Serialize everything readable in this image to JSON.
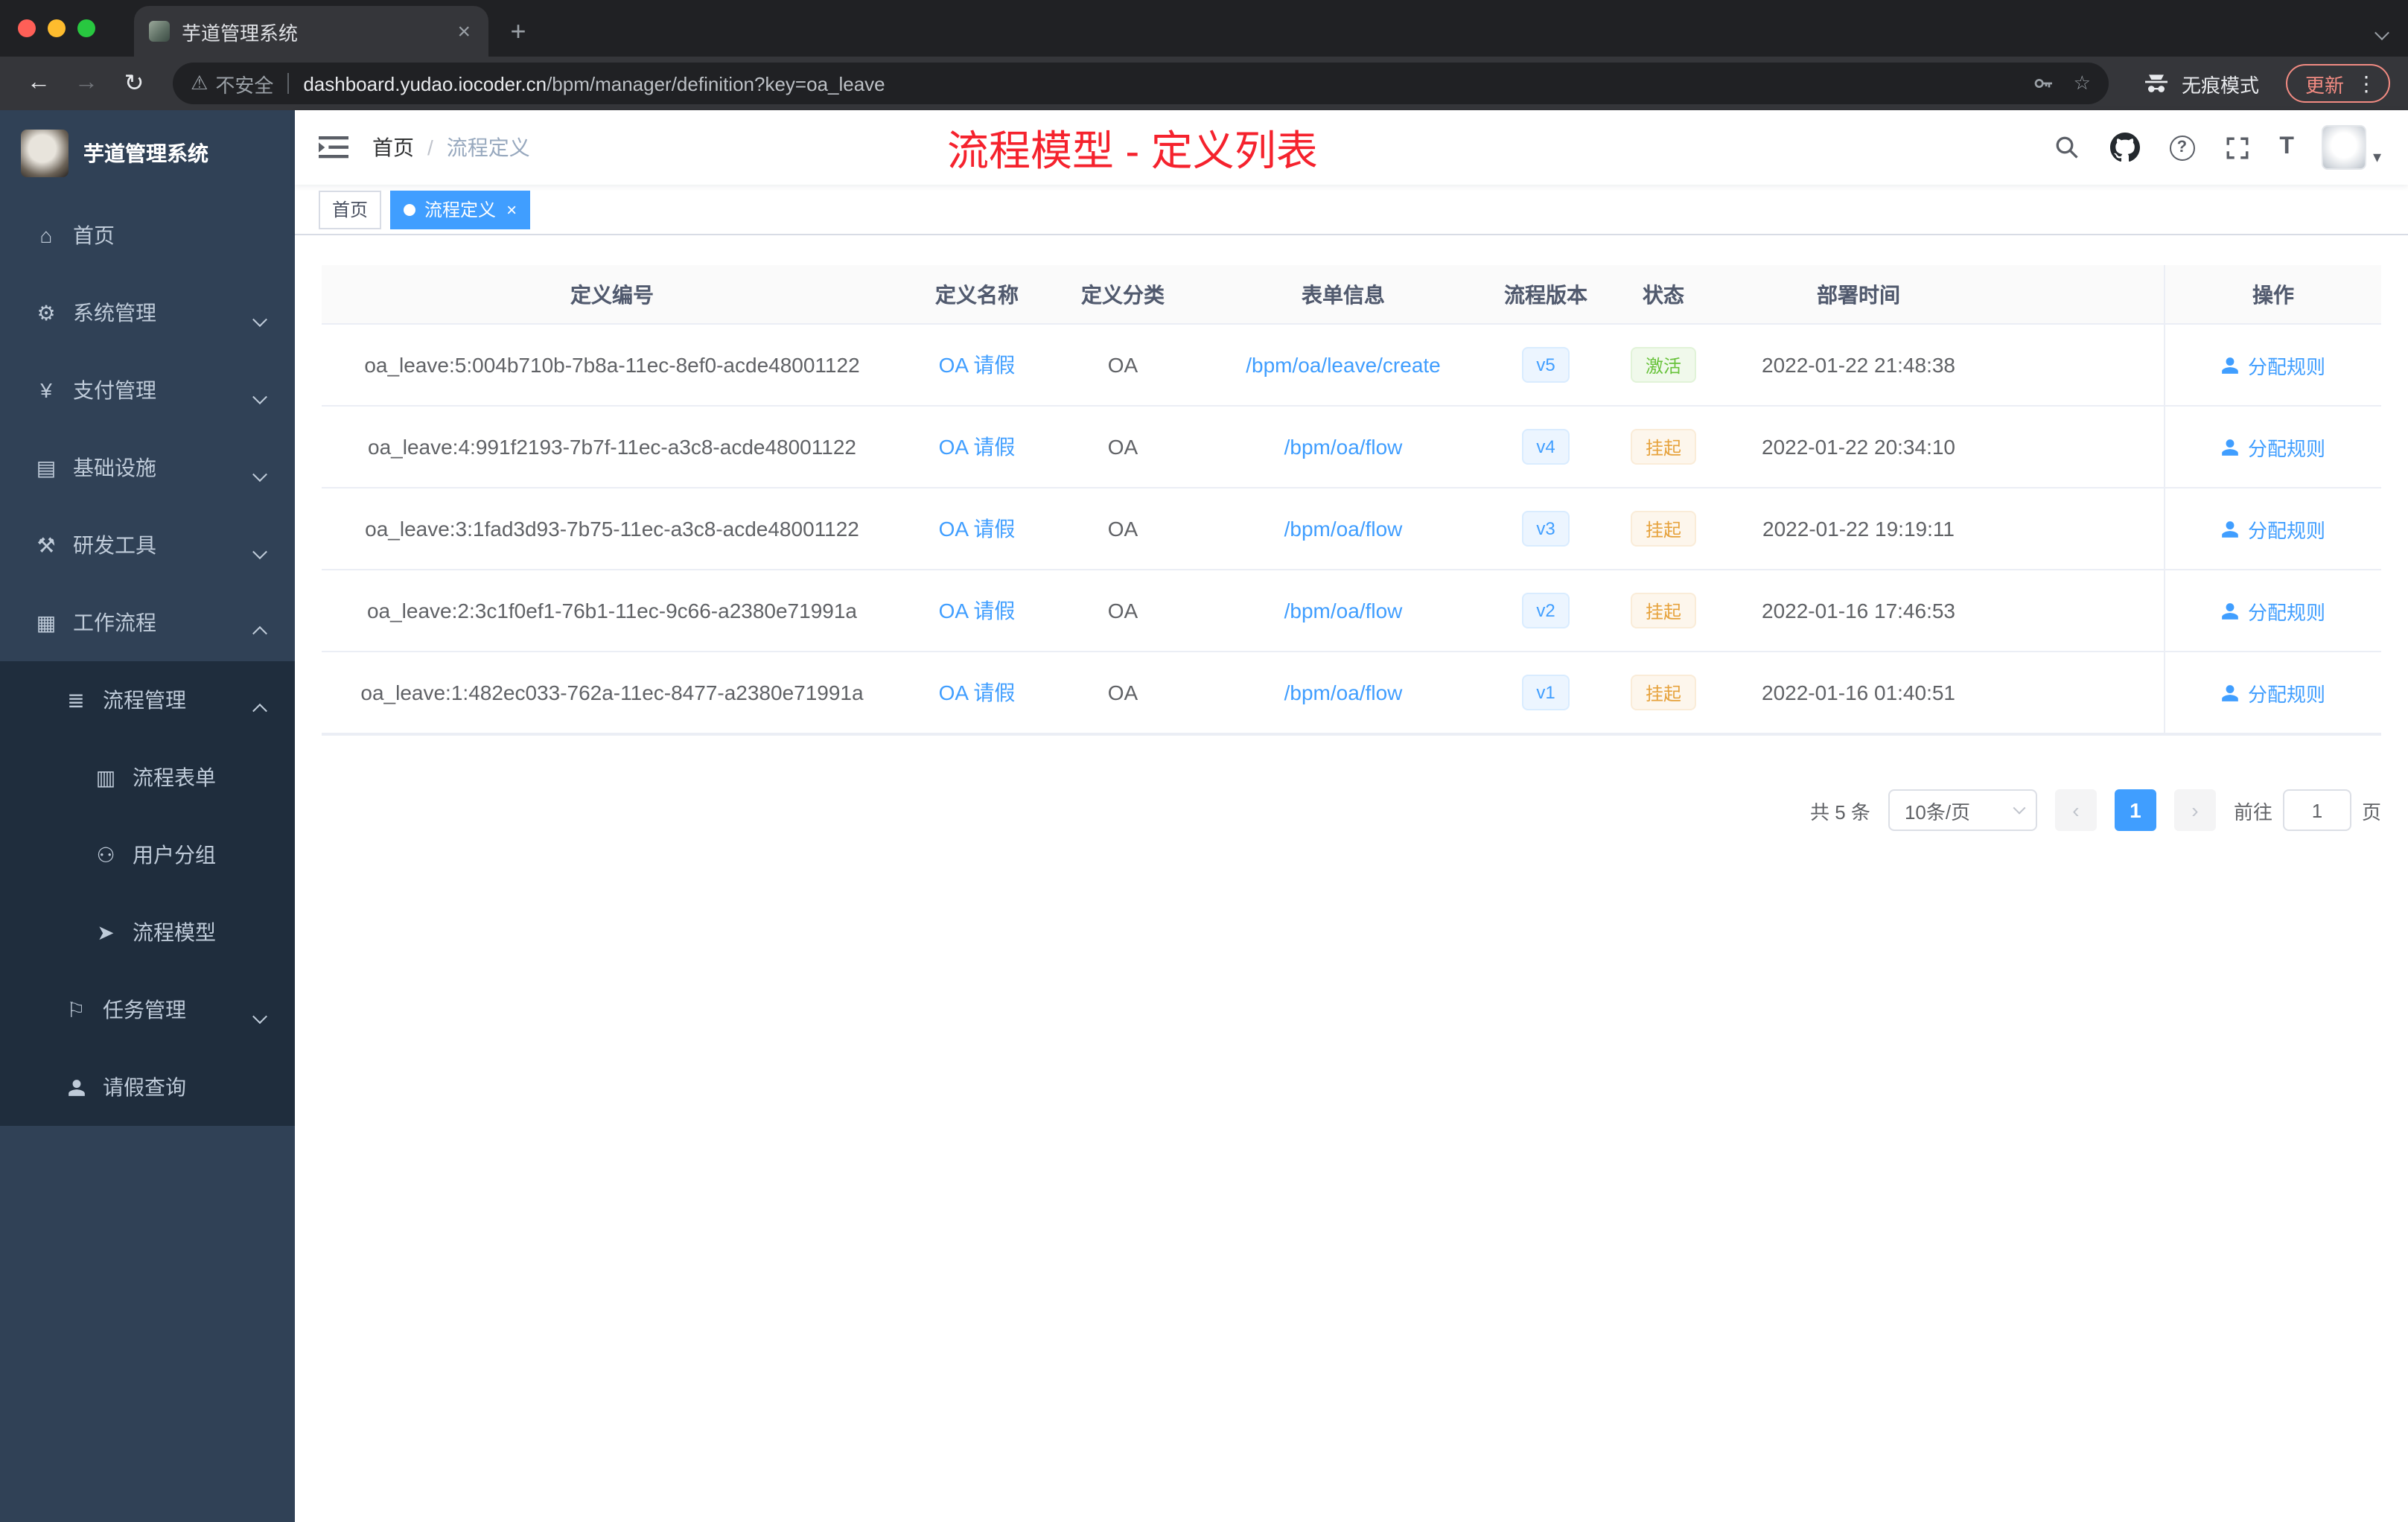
{
  "browser": {
    "tab_title": "芋道管理系统",
    "security_label": "不安全",
    "url_host": "dashboard.yudao.iocoder.cn",
    "url_path": "/bpm/manager/definition?key=oa_leave",
    "incognito_label": "无痕模式",
    "update_label": "更新"
  },
  "icons": {
    "back": "←",
    "forward": "→",
    "reload": "↻",
    "warning": "⚠",
    "star": "☆",
    "kebab": "⋮",
    "new_tab": "+",
    "tab_close": "×",
    "question": "?",
    "size": "T",
    "caret": "▾"
  },
  "sidebar": {
    "logo_title": "芋道管理系统",
    "items": [
      {
        "label": "首页",
        "glyph": "⌂"
      },
      {
        "label": "系统管理",
        "glyph": "⚙"
      },
      {
        "label": "支付管理",
        "glyph": "¥"
      },
      {
        "label": "基础设施",
        "glyph": "▤"
      },
      {
        "label": "研发工具",
        "glyph": "⚒"
      },
      {
        "label": "工作流程",
        "glyph": "▦"
      },
      {
        "label": "流程管理",
        "glyph": "≣"
      },
      {
        "label": "流程表单",
        "glyph": "▥"
      },
      {
        "label": "用户分组",
        "glyph": "⚇"
      },
      {
        "label": "流程模型",
        "glyph": "➤"
      },
      {
        "label": "任务管理",
        "glyph": "⚐"
      },
      {
        "label": "请假查询",
        "glyph": ""
      }
    ]
  },
  "header": {
    "breadcrumb": {
      "home": "首页",
      "sep": "/",
      "current": "流程定义"
    },
    "annotation": "流程模型 - 定义列表"
  },
  "tags": {
    "items": [
      {
        "label": "首页"
      },
      {
        "label": "流程定义",
        "close": "×"
      }
    ]
  },
  "table": {
    "columns": [
      "定义编号",
      "定义名称",
      "定义分类",
      "表单信息",
      "流程版本",
      "状态",
      "部署时间",
      "操作"
    ],
    "rows": [
      {
        "id": "oa_leave:5:004b710b-7b8a-11ec-8ef0-acde48001122",
        "name": "OA 请假",
        "category": "OA",
        "form": "/bpm/oa/leave/create",
        "version": "v5",
        "status": "激活",
        "status_type": "success",
        "deployed_at": "2022-01-22 21:48:38",
        "action": "分配规则"
      },
      {
        "id": "oa_leave:4:991f2193-7b7f-11ec-a3c8-acde48001122",
        "name": "OA 请假",
        "category": "OA",
        "form": "/bpm/oa/flow",
        "version": "v4",
        "status": "挂起",
        "status_type": "warning",
        "deployed_at": "2022-01-22 20:34:10",
        "action": "分配规则"
      },
      {
        "id": "oa_leave:3:1fad3d93-7b75-11ec-a3c8-acde48001122",
        "name": "OA 请假",
        "category": "OA",
        "form": "/bpm/oa/flow",
        "version": "v3",
        "status": "挂起",
        "status_type": "warning",
        "deployed_at": "2022-01-22 19:19:11",
        "action": "分配规则"
      },
      {
        "id": "oa_leave:2:3c1f0ef1-76b1-11ec-9c66-a2380e71991a",
        "name": "OA 请假",
        "category": "OA",
        "form": "/bpm/oa/flow",
        "version": "v2",
        "status": "挂起",
        "status_type": "warning",
        "deployed_at": "2022-01-16 17:46:53",
        "action": "分配规则"
      },
      {
        "id": "oa_leave:1:482ec033-762a-11ec-8477-a2380e71991a",
        "name": "OA 请假",
        "category": "OA",
        "form": "/bpm/oa/flow",
        "version": "v1",
        "status": "挂起",
        "status_type": "warning",
        "deployed_at": "2022-01-16 01:40:51",
        "action": "分配规则"
      }
    ]
  },
  "pagination": {
    "total": "共 5 条",
    "page_size": "10条/页",
    "prev": "‹",
    "page": "1",
    "next": "›",
    "goto_prefix": "前往",
    "goto_value": "1",
    "goto_suffix": "页"
  }
}
